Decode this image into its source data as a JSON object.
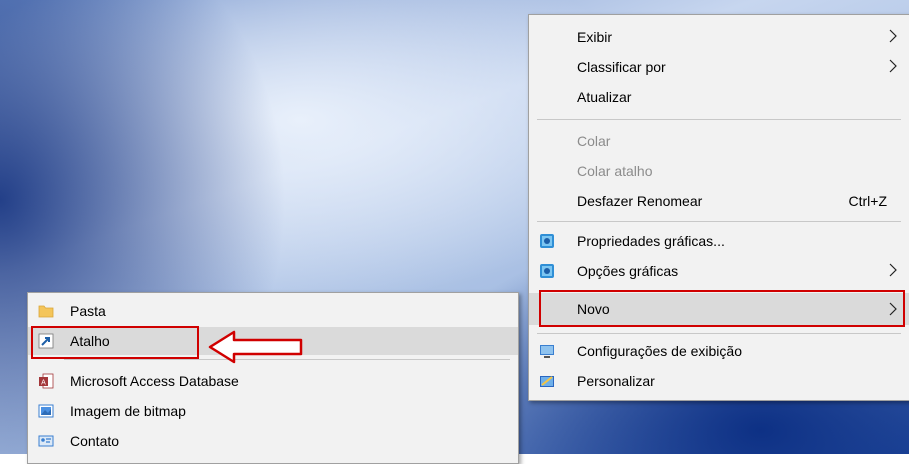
{
  "context_menu": {
    "items": [
      {
        "label": "Exibir",
        "has_submenu": true
      },
      {
        "label": "Classificar por",
        "has_submenu": true
      },
      {
        "label": "Atualizar"
      },
      {
        "label": "Colar",
        "disabled": true
      },
      {
        "label": "Colar atalho",
        "disabled": true
      },
      {
        "label": "Desfazer Renomear",
        "shortcut": "Ctrl+Z"
      },
      {
        "label": "Propriedades gráficas...",
        "icon": "graphics-icon"
      },
      {
        "label": "Opções gráficas",
        "icon": "graphics-icon",
        "has_submenu": true
      },
      {
        "label": "Novo",
        "has_submenu": true,
        "highlighted": true
      },
      {
        "label": "Configurações de exibição",
        "icon": "display-settings-icon"
      },
      {
        "label": "Personalizar",
        "icon": "personalize-icon"
      }
    ]
  },
  "new_submenu": {
    "items": [
      {
        "label": "Pasta",
        "icon": "folder-icon"
      },
      {
        "label": "Atalho",
        "icon": "shortcut-icon",
        "highlighted": true
      },
      {
        "label": "Microsoft Access Database",
        "icon": "access-database-icon"
      },
      {
        "label": "Imagem de bitmap",
        "icon": "bitmap-image-icon"
      },
      {
        "label": "Contato",
        "icon": "contact-icon"
      }
    ]
  },
  "annotations": {
    "highlight_color": "#d00000",
    "arrow": "left-pointing outline arrow toward Atalho"
  }
}
